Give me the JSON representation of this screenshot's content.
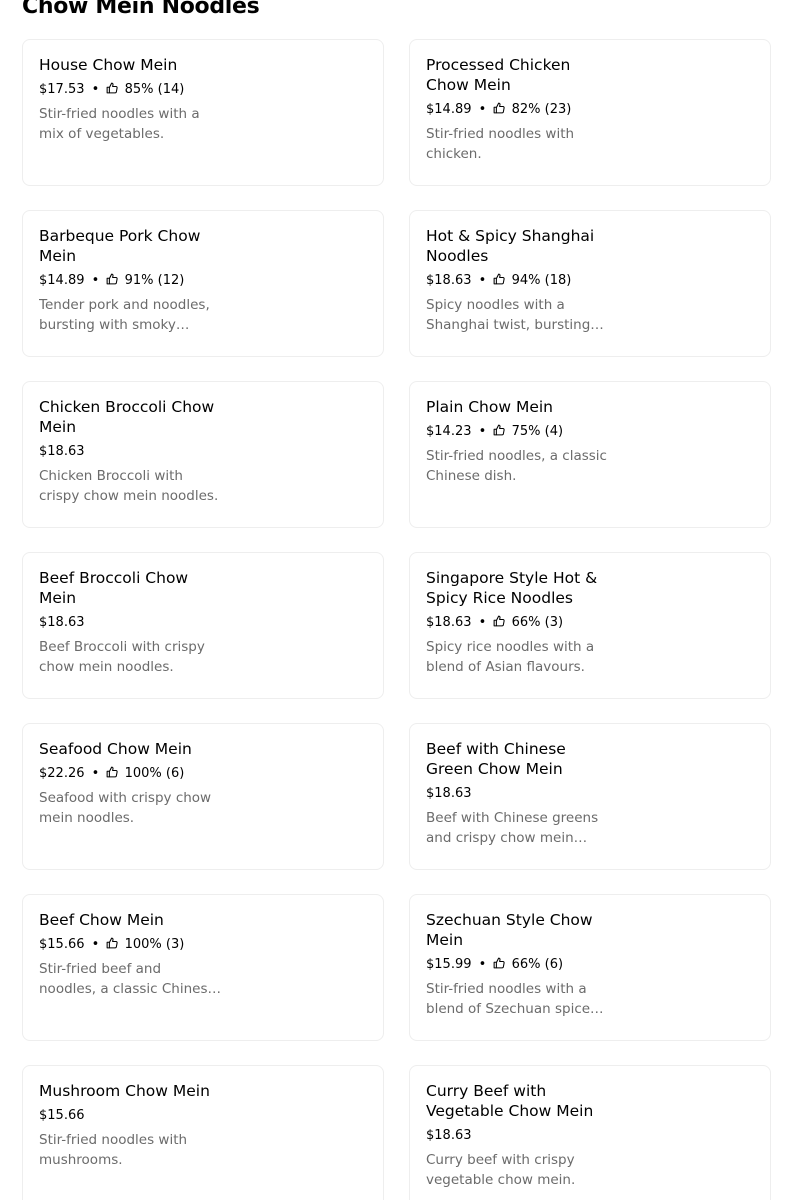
{
  "section": {
    "title": "Chow Mein Noodles"
  },
  "items": [
    {
      "name": "House Chow Mein",
      "price": "$17.53",
      "rating": "85% (14)",
      "desc": "Stir-fried noodles with a mix of vegetables."
    },
    {
      "name": "Processed Chicken Chow Mein",
      "price": "$14.89",
      "rating": "82% (23)",
      "desc": "Stir-fried noodles with chicken."
    },
    {
      "name": "Barbeque Pork Chow Mein",
      "price": "$14.89",
      "rating": "91% (12)",
      "desc": "Tender pork and noodles, bursting with smoky barbeque flavour."
    },
    {
      "name": "Hot & Spicy Shanghai Noodles",
      "price": "$18.63",
      "rating": "94% (18)",
      "desc": "Spicy noodles with a Shanghai twist, bursting with flavour."
    },
    {
      "name": "Chicken Broccoli Chow Mein",
      "price": "$18.63",
      "rating": "",
      "desc": "Chicken Broccoli with crispy chow mein noodles."
    },
    {
      "name": "Plain Chow Mein",
      "price": "$14.23",
      "rating": "75% (4)",
      "desc": "Stir-fried noodles, a classic Chinese dish."
    },
    {
      "name": "Beef Broccoli Chow Mein",
      "price": "$18.63",
      "rating": "",
      "desc": "Beef Broccoli with crispy chow mein noodles."
    },
    {
      "name": "Singapore Style Hot & Spicy Rice Noodles",
      "price": "$18.63",
      "rating": "66% (3)",
      "desc": "Spicy rice noodles with a blend of Asian flavours."
    },
    {
      "name": "Seafood Chow Mein",
      "price": "$22.26",
      "rating": "100% (6)",
      "desc": "Seafood with crispy chow mein noodles."
    },
    {
      "name": "Beef with Chinese Green Chow Mein",
      "price": "$18.63",
      "rating": "",
      "desc": "Beef with Chinese greens and crispy chow mein noodles."
    },
    {
      "name": "Beef Chow Mein",
      "price": "$15.66",
      "rating": "100% (3)",
      "desc": "Stir-fried beef and noodles, a classic Chinese dish."
    },
    {
      "name": "Szechuan Style Chow Mein",
      "price": "$15.99",
      "rating": "66% (6)",
      "desc": "Stir-fried noodles with a blend of Szechuan spices and flavours."
    },
    {
      "name": "Mushroom Chow Mein",
      "price": "$15.66",
      "rating": "",
      "desc": "Stir-fried noodles with mushrooms."
    },
    {
      "name": "Curry Beef with Vegetable Chow Mein",
      "price": "$18.63",
      "rating": "",
      "desc": "Curry beef with crispy vegetable chow mein."
    }
  ],
  "meta_separator": "•",
  "rating_icon": "thumbs-up-icon"
}
